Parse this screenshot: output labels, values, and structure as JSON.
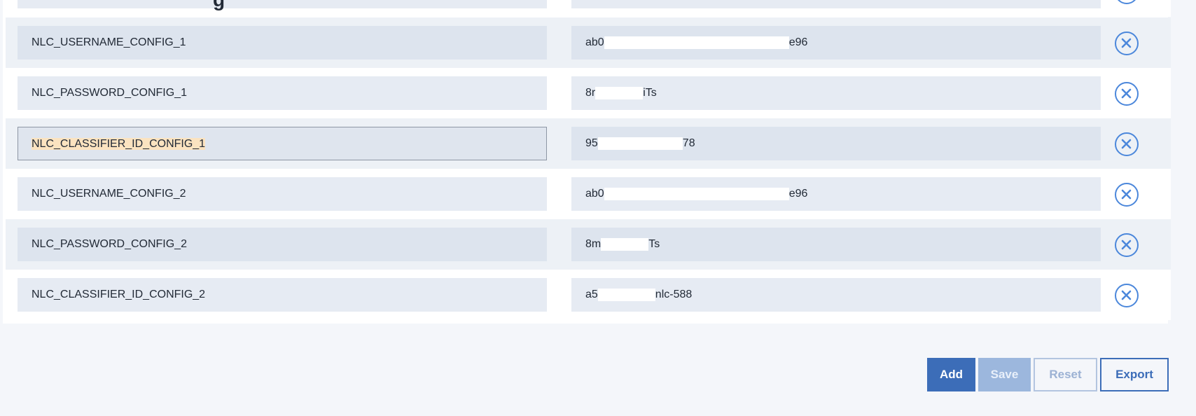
{
  "page_title_fragment": "g",
  "rows": [
    {
      "key": "NLC_USERNAME_CONFIG_1",
      "value_prefix": "ab0",
      "value_suffix": "e96"
    },
    {
      "key": "NLC_PASSWORD_CONFIG_1",
      "value_prefix": "8r",
      "value_suffix": "iTs"
    },
    {
      "key": "NLC_CLASSIFIER_ID_CONFIG_1",
      "value_prefix": "95",
      "value_suffix": "78"
    },
    {
      "key": "NLC_USERNAME_CONFIG_2",
      "value_prefix": "ab0",
      "value_suffix": "e96"
    },
    {
      "key": "NLC_PASSWORD_CONFIG_2",
      "value_prefix": "8m",
      "value_suffix": "Ts"
    },
    {
      "key": "NLC_CLASSIFIER_ID_CONFIG_2",
      "value_prefix": "a5",
      "value_suffix": "nlc-588"
    }
  ],
  "buttons": {
    "add": "Add",
    "save": "Save",
    "reset": "Reset",
    "export": "Export"
  },
  "icons": {
    "remove": "close-circle-icon"
  },
  "colors": {
    "accent": "#3c6db8",
    "remove_icon": "#4b87db",
    "highlight": "#fbe3c0"
  }
}
